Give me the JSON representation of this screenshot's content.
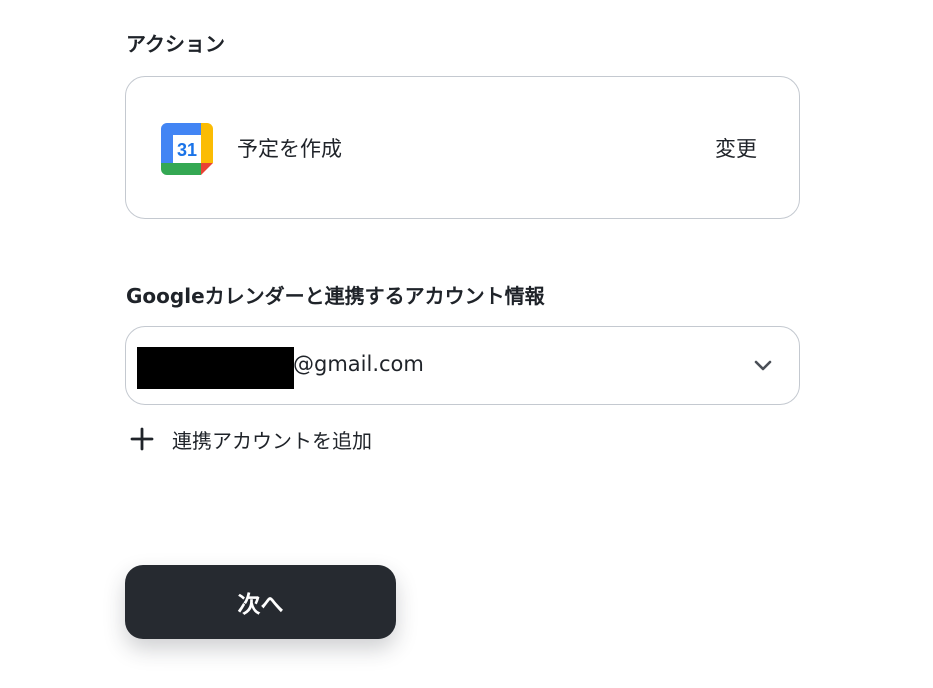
{
  "action_section": {
    "label": "アクション",
    "action_name": "予定を作成",
    "change_label": "変更",
    "app_icon": "google-calendar-icon",
    "calendar_icon_day": "31"
  },
  "account_section": {
    "label": "Googleカレンダーと連携するアカウント情報",
    "email_visible_suffix": "@gmail.com",
    "dropdown_icon": "chevron-down-icon",
    "add_account_label": "連携アカウントを追加",
    "add_icon": "plus-icon"
  },
  "next_button": {
    "label": "次へ"
  },
  "colors": {
    "primary_button": "#262a30",
    "text": "#1f2329",
    "border": "#c4c9d0",
    "calendar_blue": "#4285f4",
    "calendar_green": "#34a853",
    "calendar_yellow": "#fbbc04",
    "calendar_red": "#ea4335"
  }
}
